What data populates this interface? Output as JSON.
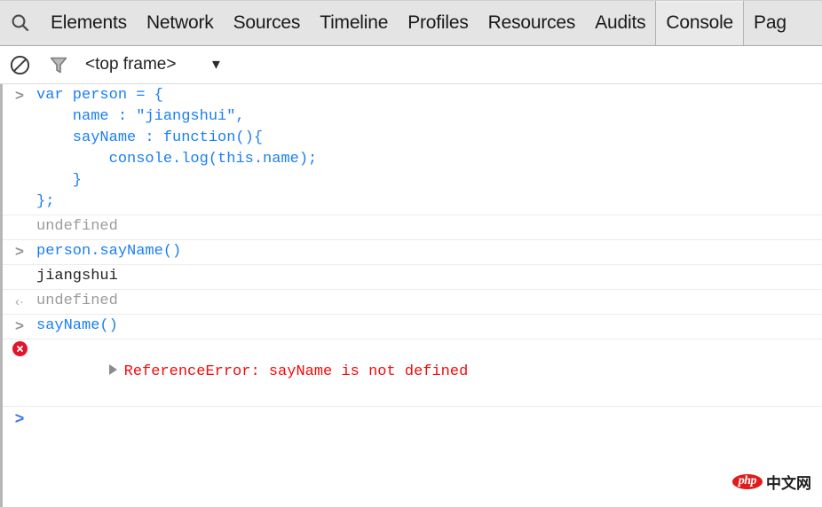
{
  "tabbar": {
    "search_icon": "search-icon",
    "tabs": [
      {
        "label": "Elements",
        "selected": false
      },
      {
        "label": "Network",
        "selected": false
      },
      {
        "label": "Sources",
        "selected": false
      },
      {
        "label": "Timeline",
        "selected": false
      },
      {
        "label": "Profiles",
        "selected": false
      },
      {
        "label": "Resources",
        "selected": false
      },
      {
        "label": "Audits",
        "selected": false
      },
      {
        "label": "Console",
        "selected": true
      },
      {
        "label": "Pag",
        "selected": false
      }
    ]
  },
  "toolbar": {
    "clear_icon": "clear-console-icon",
    "filter_icon": "filter-icon",
    "frame_selector_value": "<top frame>",
    "frame_selector_caret": "▼"
  },
  "console": {
    "messages": [
      {
        "type": "input",
        "marker": ">",
        "text": "var person = {\n    name : \"jiangshui\",\n    sayName : function(){\n        console.log(this.name);\n    }\n};"
      },
      {
        "type": "result-undefined",
        "marker": "",
        "text": "undefined"
      },
      {
        "type": "input",
        "marker": ">",
        "text": "person.sayName()"
      },
      {
        "type": "log",
        "marker": "",
        "text": "jiangshui"
      },
      {
        "type": "result-undefined",
        "marker": "‹·",
        "text": "undefined"
      },
      {
        "type": "input",
        "marker": ">",
        "text": "sayName()"
      },
      {
        "type": "error",
        "marker": "error-icon",
        "expand": "▶",
        "text": "ReferenceError: sayName is not defined"
      },
      {
        "type": "prompt",
        "marker": ">",
        "text": ""
      }
    ]
  },
  "watermark": {
    "logo_text": "php",
    "site_text": "中文网"
  },
  "colors": {
    "input_blue": "#1a7ff4",
    "error_red": "#f40a0a",
    "undefined_gray": "#9b9b9b",
    "log_dark": "#222222",
    "tabbar_bg": "#e4e4e4",
    "selected_tab_bg": "#e9e9e9",
    "error_badge": "#e4142a"
  }
}
